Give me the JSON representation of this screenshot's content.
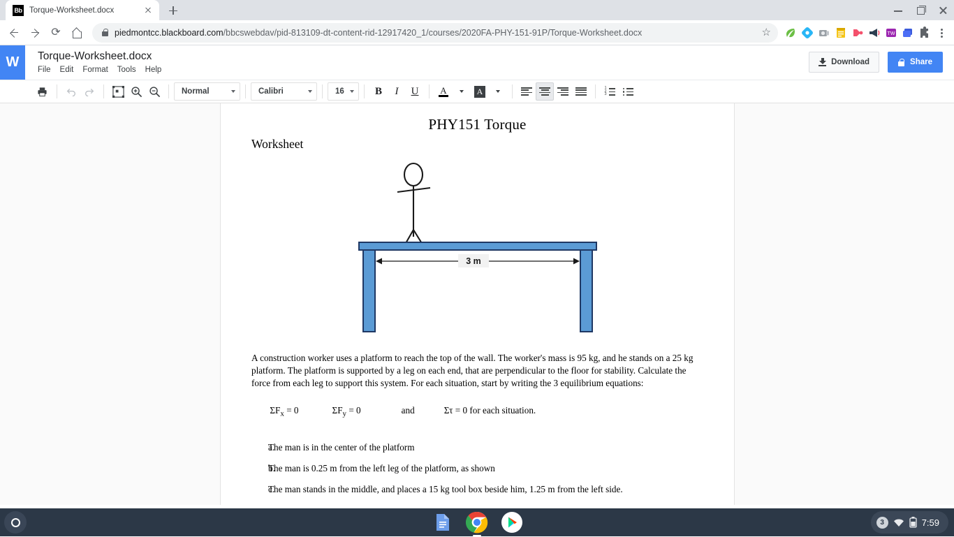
{
  "browser": {
    "tab": {
      "favicon_text": "Bb",
      "title": "Torque-Worksheet.docx",
      "favicon_name": "blackboard-favicon"
    },
    "new_tab_label": "+",
    "url_host": "piedmontcc.blackboard.com",
    "url_path": "/bbcswebdav/pid-813109-dt-content-rid-12917420_1/courses/2020FA-PHY-151-91P/Torque-Worksheet.docx",
    "extensions": [
      {
        "name": "leaf-extension-icon",
        "color": "#6cbf45"
      },
      {
        "name": "diamond-extension-icon",
        "color": "#29b6f6"
      },
      {
        "name": "camera-extension-icon",
        "color": "#9aa0a6"
      },
      {
        "name": "notes-extension-icon",
        "color": "#f5c518"
      },
      {
        "name": "play-extension-icon",
        "color": "#f4516c"
      },
      {
        "name": "megaphone-extension-icon",
        "color": "#2c3e50"
      },
      {
        "name": "tw-extension-icon",
        "color": "#9c27b0"
      },
      {
        "name": "blue-square-extension-icon",
        "color": "#3b5bdb"
      },
      {
        "name": "puzzle-extensions-icon",
        "color": "#5f6368"
      }
    ]
  },
  "docs": {
    "logo_letter": "W",
    "filename": "Torque-Worksheet.docx",
    "menu": [
      "File",
      "Edit",
      "Format",
      "Tools",
      "Help"
    ],
    "download_label": "Download",
    "share_label": "Share",
    "toolbar": {
      "style": "Normal",
      "font": "Calibri",
      "size": "16",
      "bold": "B",
      "italic": "I",
      "underline": "U",
      "text_color": "A",
      "highlight_color": "A"
    }
  },
  "document": {
    "title": "PHY151 Torque",
    "subtitle": "Worksheet",
    "figure": {
      "dimension_label": "3 m",
      "platform_color": "#5b9bd5",
      "outline_color": "#1f3864"
    },
    "paragraph": "A construction worker uses a platform to reach the top of the wall.  The worker's mass is 95 kg, and he stands on a 25 kg platform.  The platform is supported by a leg on each end, that are perpendicular to the floor for stability.  Calculate the force from each leg to support this system.   For each situation, start by writing the 3 equilibrium equations:",
    "equations": {
      "fx": "ΣF",
      "fx_sub": "x",
      "fx_eq": " = 0",
      "fy": "ΣF",
      "fy_sub": "y",
      "fy_eq": " = 0",
      "and": "and",
      "tau": "Στ = 0 for each situation."
    },
    "list": [
      {
        "marker": "a.",
        "text": "The man is in the center of the platform"
      },
      {
        "marker": "b.",
        "text": "The man is 0.25 m from the left leg of the platform, as shown"
      },
      {
        "marker": "c.",
        "text": "The man stands in the middle, and places a 15 kg tool box beside him, 1.25 m from the left side."
      }
    ]
  },
  "shelf": {
    "apps": [
      {
        "name": "google-docs-app-icon",
        "active": false
      },
      {
        "name": "chrome-app-icon",
        "active": true
      },
      {
        "name": "play-store-app-icon",
        "active": false
      }
    ],
    "notification_count": "3",
    "time": "7:59"
  }
}
